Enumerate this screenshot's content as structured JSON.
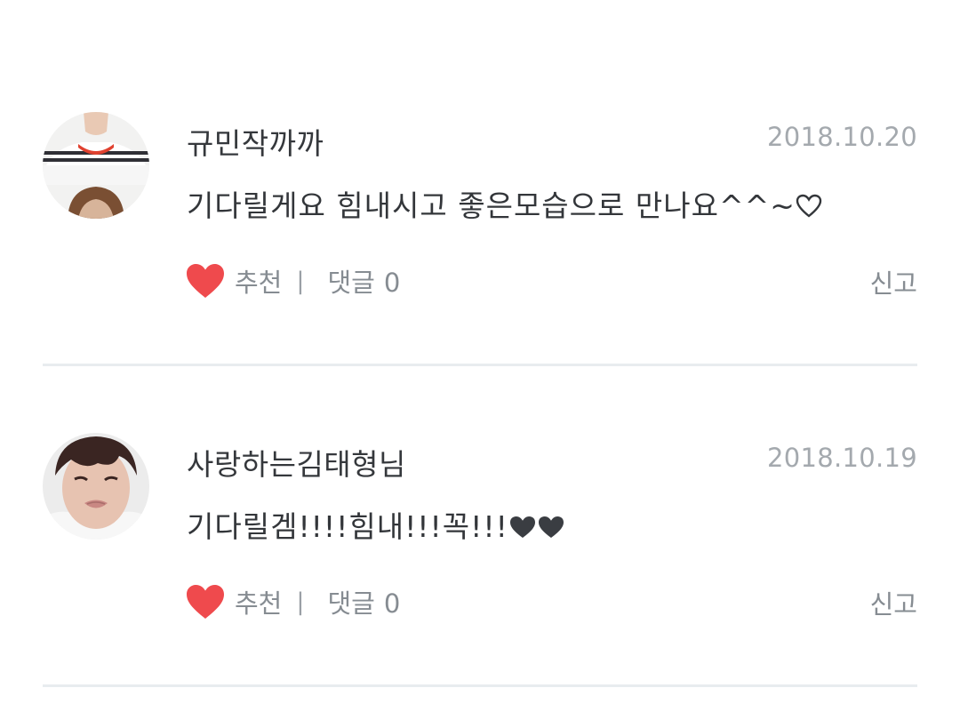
{
  "comments": [
    {
      "username": "규민작까까",
      "date": "2018.10.20",
      "text": "기다릴게요 힘내시고 좋은모습으로 만나요^^~",
      "like_label": "추천",
      "separator": "|",
      "reply_label": "댓글",
      "reply_count": "0",
      "report_label": "신고"
    },
    {
      "username": "사랑하는김태형님",
      "date": "2018.10.19",
      "text": "기다릴겜!!!!힘내!!!꼭!!!",
      "like_label": "추천",
      "separator": "|",
      "reply_label": "댓글",
      "reply_count": "0",
      "report_label": "신고"
    }
  ],
  "colors": {
    "like_heart": "#ef4a4d",
    "text_dark": "#33363a",
    "text_muted": "#868c92",
    "date": "#a4a9ae",
    "divider": "#e8ecef"
  },
  "icons": {
    "like": "heart-icon",
    "emoji_outline_heart": "outline-heart-icon",
    "emoji_filled_heart": "black-heart-icon"
  }
}
